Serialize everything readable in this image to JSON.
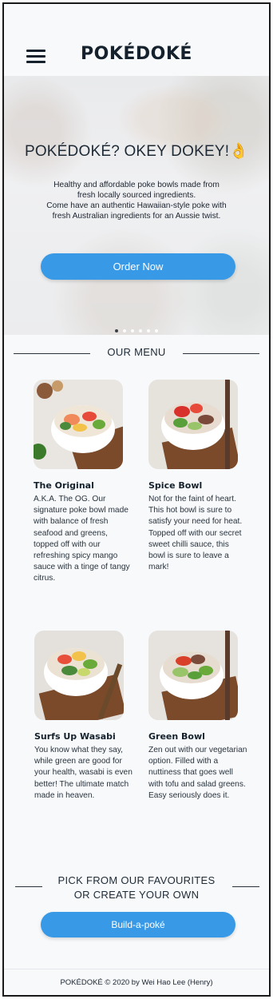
{
  "header": {
    "logo": "POKÉDOKÉ",
    "menu_icon": "hamburger-menu-icon"
  },
  "hero": {
    "title": "POKÉDOKÉ? OKEY DOKEY!",
    "title_emoji": "👌",
    "text_lines": [
      "Healthy and affordable poke bowls made from",
      "fresh locally sourced ingredients.",
      "Come have an authentic Hawaiian-style poke with",
      "fresh Australian ingredients for an Aussie twist."
    ],
    "cta_label": "Order Now",
    "carousel": {
      "slides": 6,
      "active_index": 0
    }
  },
  "menu": {
    "heading": "OUR MENU",
    "items": [
      {
        "name": "The Original",
        "description": "A.K.A. The OG. Our signature poke bowl made with balance of fresh seafood and greens, topped off with our refreshing spicy mango sauce with a tinge of tangy citrus."
      },
      {
        "name": "Spice Bowl",
        "description": "Not for the faint of heart. This hot bowl is sure to satisfy your need for heat. Topped off with our secret sweet chilli sauce, this bowl is sure to leave a mark!"
      },
      {
        "name": "Surfs Up Wasabi",
        "description": "You know what they say, while green are good for your health, wasabi is even better! The ultimate match made in heaven."
      },
      {
        "name": "Green Bowl",
        "description": "Zen out with our vegetarian option. Filled with a nuttiness that goes well with tofu and salad greens. Easy seriously does it."
      }
    ]
  },
  "favourites": {
    "heading_line1": "PICK FROM OUR FAVOURITES",
    "heading_line2": "OR CREATE YOUR OWN",
    "cta_label": "Build-a-poké"
  },
  "footer": {
    "text": "POKÉDOKÉ © 2020 by Wei Hao Lee (Henry)"
  },
  "colors": {
    "accent": "#3899e6",
    "text_dark": "#15212c",
    "background": "#f7f9fb"
  }
}
